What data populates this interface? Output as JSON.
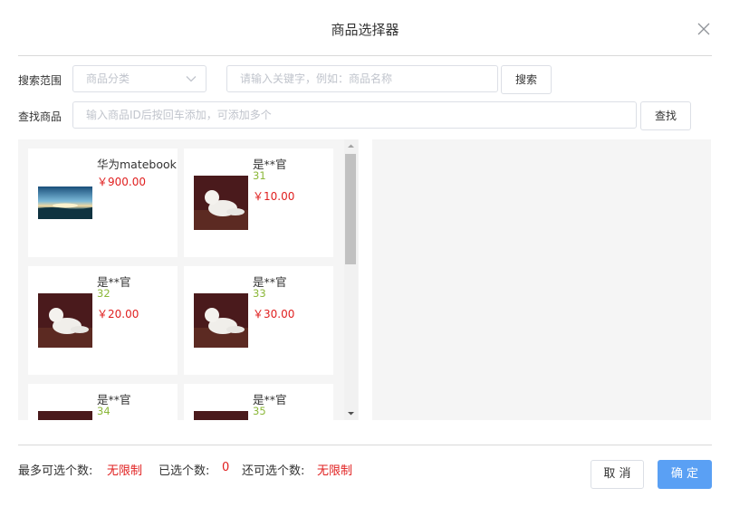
{
  "dialog": {
    "title": "商品选择器"
  },
  "filters": {
    "scope_label": "搜索范围",
    "category_placeholder": "商品分类",
    "keyword_placeholder": "请输入关键字，例如：商品名称",
    "search_button": "搜索",
    "find_label": "查找商品",
    "id_placeholder": "输入商品ID后按回车添加，可添加多个",
    "find_button": "查找"
  },
  "products": [
    {
      "name": "华为matebook",
      "sub": "",
      "price": "￥900.00",
      "image": "sunset-landscape"
    },
    {
      "name": "是**官",
      "sub": "31",
      "price": "￥10.00",
      "image": "white-dog-photo"
    },
    {
      "name": "是**官",
      "sub": "32",
      "price": "￥20.00",
      "image": "white-dog-photo"
    },
    {
      "name": "是**官",
      "sub": "33",
      "price": "￥30.00",
      "image": "white-dog-photo"
    },
    {
      "name": "是**官",
      "sub": "34",
      "price": "",
      "image": "white-dog-photo"
    },
    {
      "name": "是**官",
      "sub": "35",
      "price": "",
      "image": "white-dog-photo"
    }
  ],
  "footer": {
    "max_label": "最多可选个数:",
    "max_value": "无限制",
    "selected_label": "已选个数:",
    "selected_value": "0",
    "remaining_label": "还可选个数:",
    "remaining_value": "无限制",
    "cancel_button": "取 消",
    "ok_button": "确 定"
  },
  "colors": {
    "accent": "#5aa0f4",
    "price": "#e02020",
    "sub": "#8cb83a"
  }
}
